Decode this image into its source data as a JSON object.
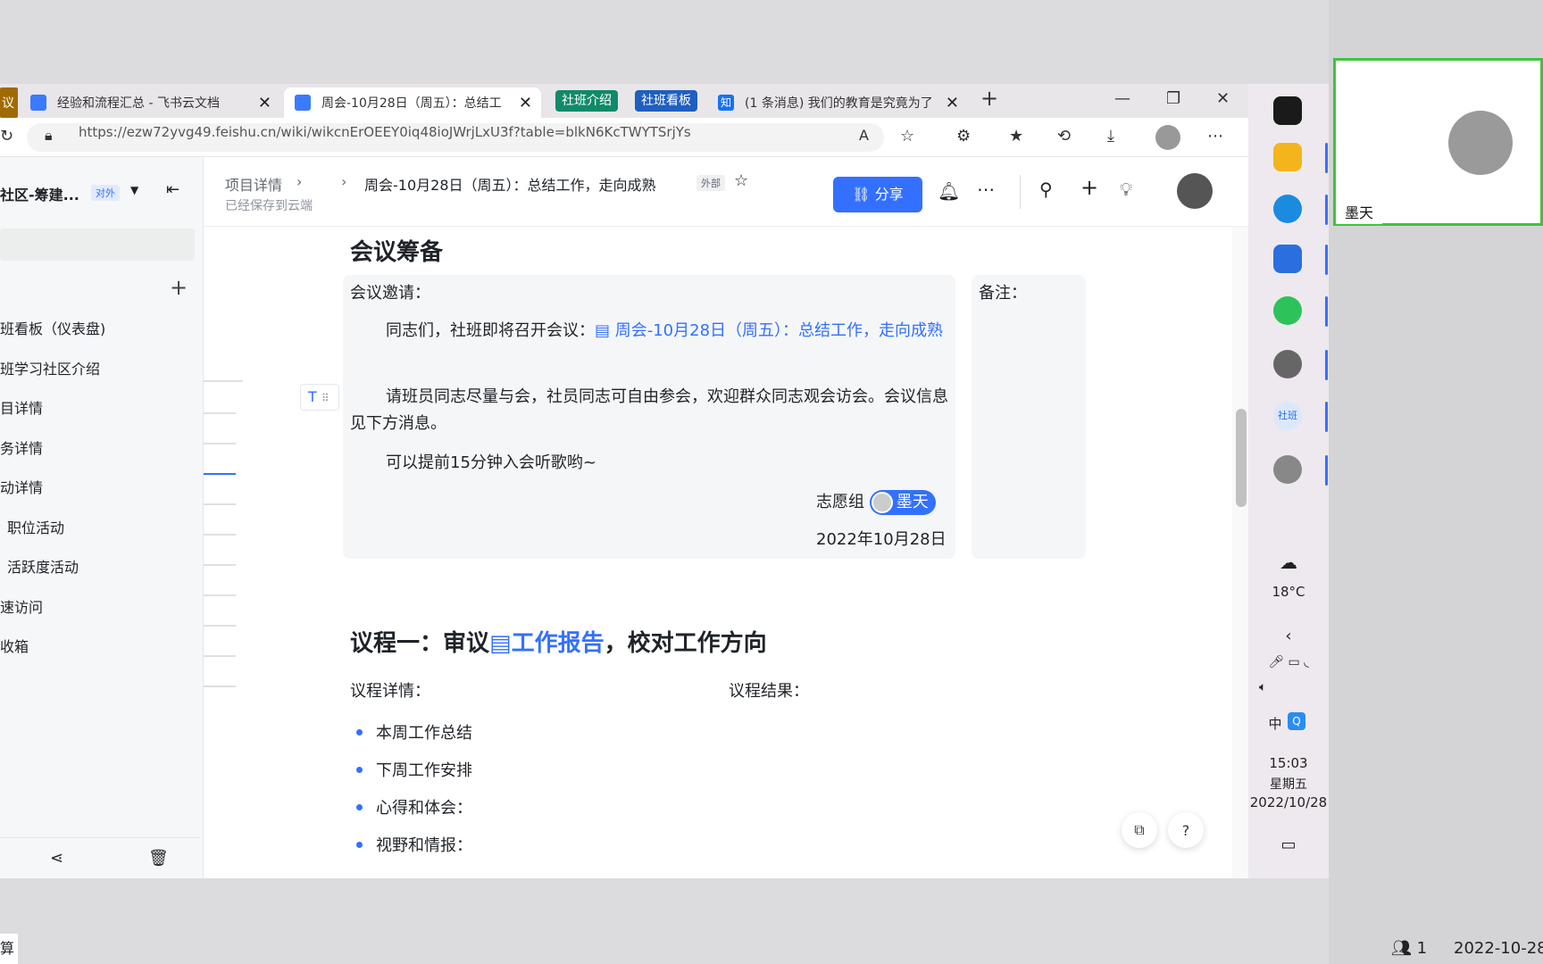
{
  "browser": {
    "tabs": [
      {
        "label": "议"
      },
      {
        "label": "经验和流程汇总 - 飞书云文档"
      },
      {
        "label": "周会-10月28日（周五）：总结工"
      },
      {
        "label": "社班介绍"
      },
      {
        "label": "社班看板"
      },
      {
        "label": "(1 条消息) 我们的教育是究竟为了"
      }
    ],
    "new_tab": "+",
    "close": "✕",
    "url": "https://ezw72yvg49.feishu.cn/wiki/wikcnErOEEY0iq48ioJWrjLxU3f?table=blkN6KcTWYTSrjYs",
    "accent_green": "#0f8a6a",
    "accent_blue": "#1f5fbf",
    "zhihu_icon": "知"
  },
  "sidebar": {
    "title": "社区-筹建...",
    "badge": "对外",
    "add": "+",
    "items": [
      {
        "label": "班看板（仪表盘)"
      },
      {
        "label": "班学习社区介绍"
      },
      {
        "label": "目详情"
      },
      {
        "label": "务详情"
      },
      {
        "label": "动详情"
      },
      {
        "label": "职位活动"
      },
      {
        "label": "活跃度活动"
      },
      {
        "label": "速访问"
      },
      {
        "label": "收箱"
      }
    ]
  },
  "doc_header": {
    "breadcrumb_parent": "项目详情",
    "saved_status": "已经保存到云端",
    "title": "周会-10月28日（周五）：总结工作，走向成熟",
    "badge": "外部",
    "share_label": "分享"
  },
  "doc": {
    "section1_title": "会议筹备",
    "invite_label": "会议邀请：",
    "notes_label": "备注：",
    "para1_prefix": "同志们，社班即将召开会议：",
    "para1_link": "周会-10月28日（周五）：总结工作，走向成熟",
    "para2": "请班员同志尽量与会，社员同志可自由参会，欢迎群众同志观会访会。会议信息见下方消息。",
    "para3": "可以提前15分钟入会听歌哟~",
    "signature_group": "志愿组",
    "signature_mention": "墨天",
    "date": "2022年10月28日",
    "agenda1_prefix": "议程一：审议",
    "agenda1_link": "工作报告",
    "agenda1_suffix": "，校对工作方向",
    "agenda_details_label": "议程详情：",
    "agenda_result_label": "议程结果：",
    "bullets": [
      "本周工作总结",
      "下周工作安排",
      "心得和体会：",
      "视野和情报："
    ]
  },
  "taskbar": {
    "temperature": "18°C",
    "time": "15:03",
    "weekday": "星期五",
    "date": "2022/10/28",
    "ime": "中",
    "app_shebān": "社班"
  },
  "video": {
    "name": "墨天",
    "participants": "1",
    "date": "2022-10-28",
    "bottom_left": "算"
  }
}
